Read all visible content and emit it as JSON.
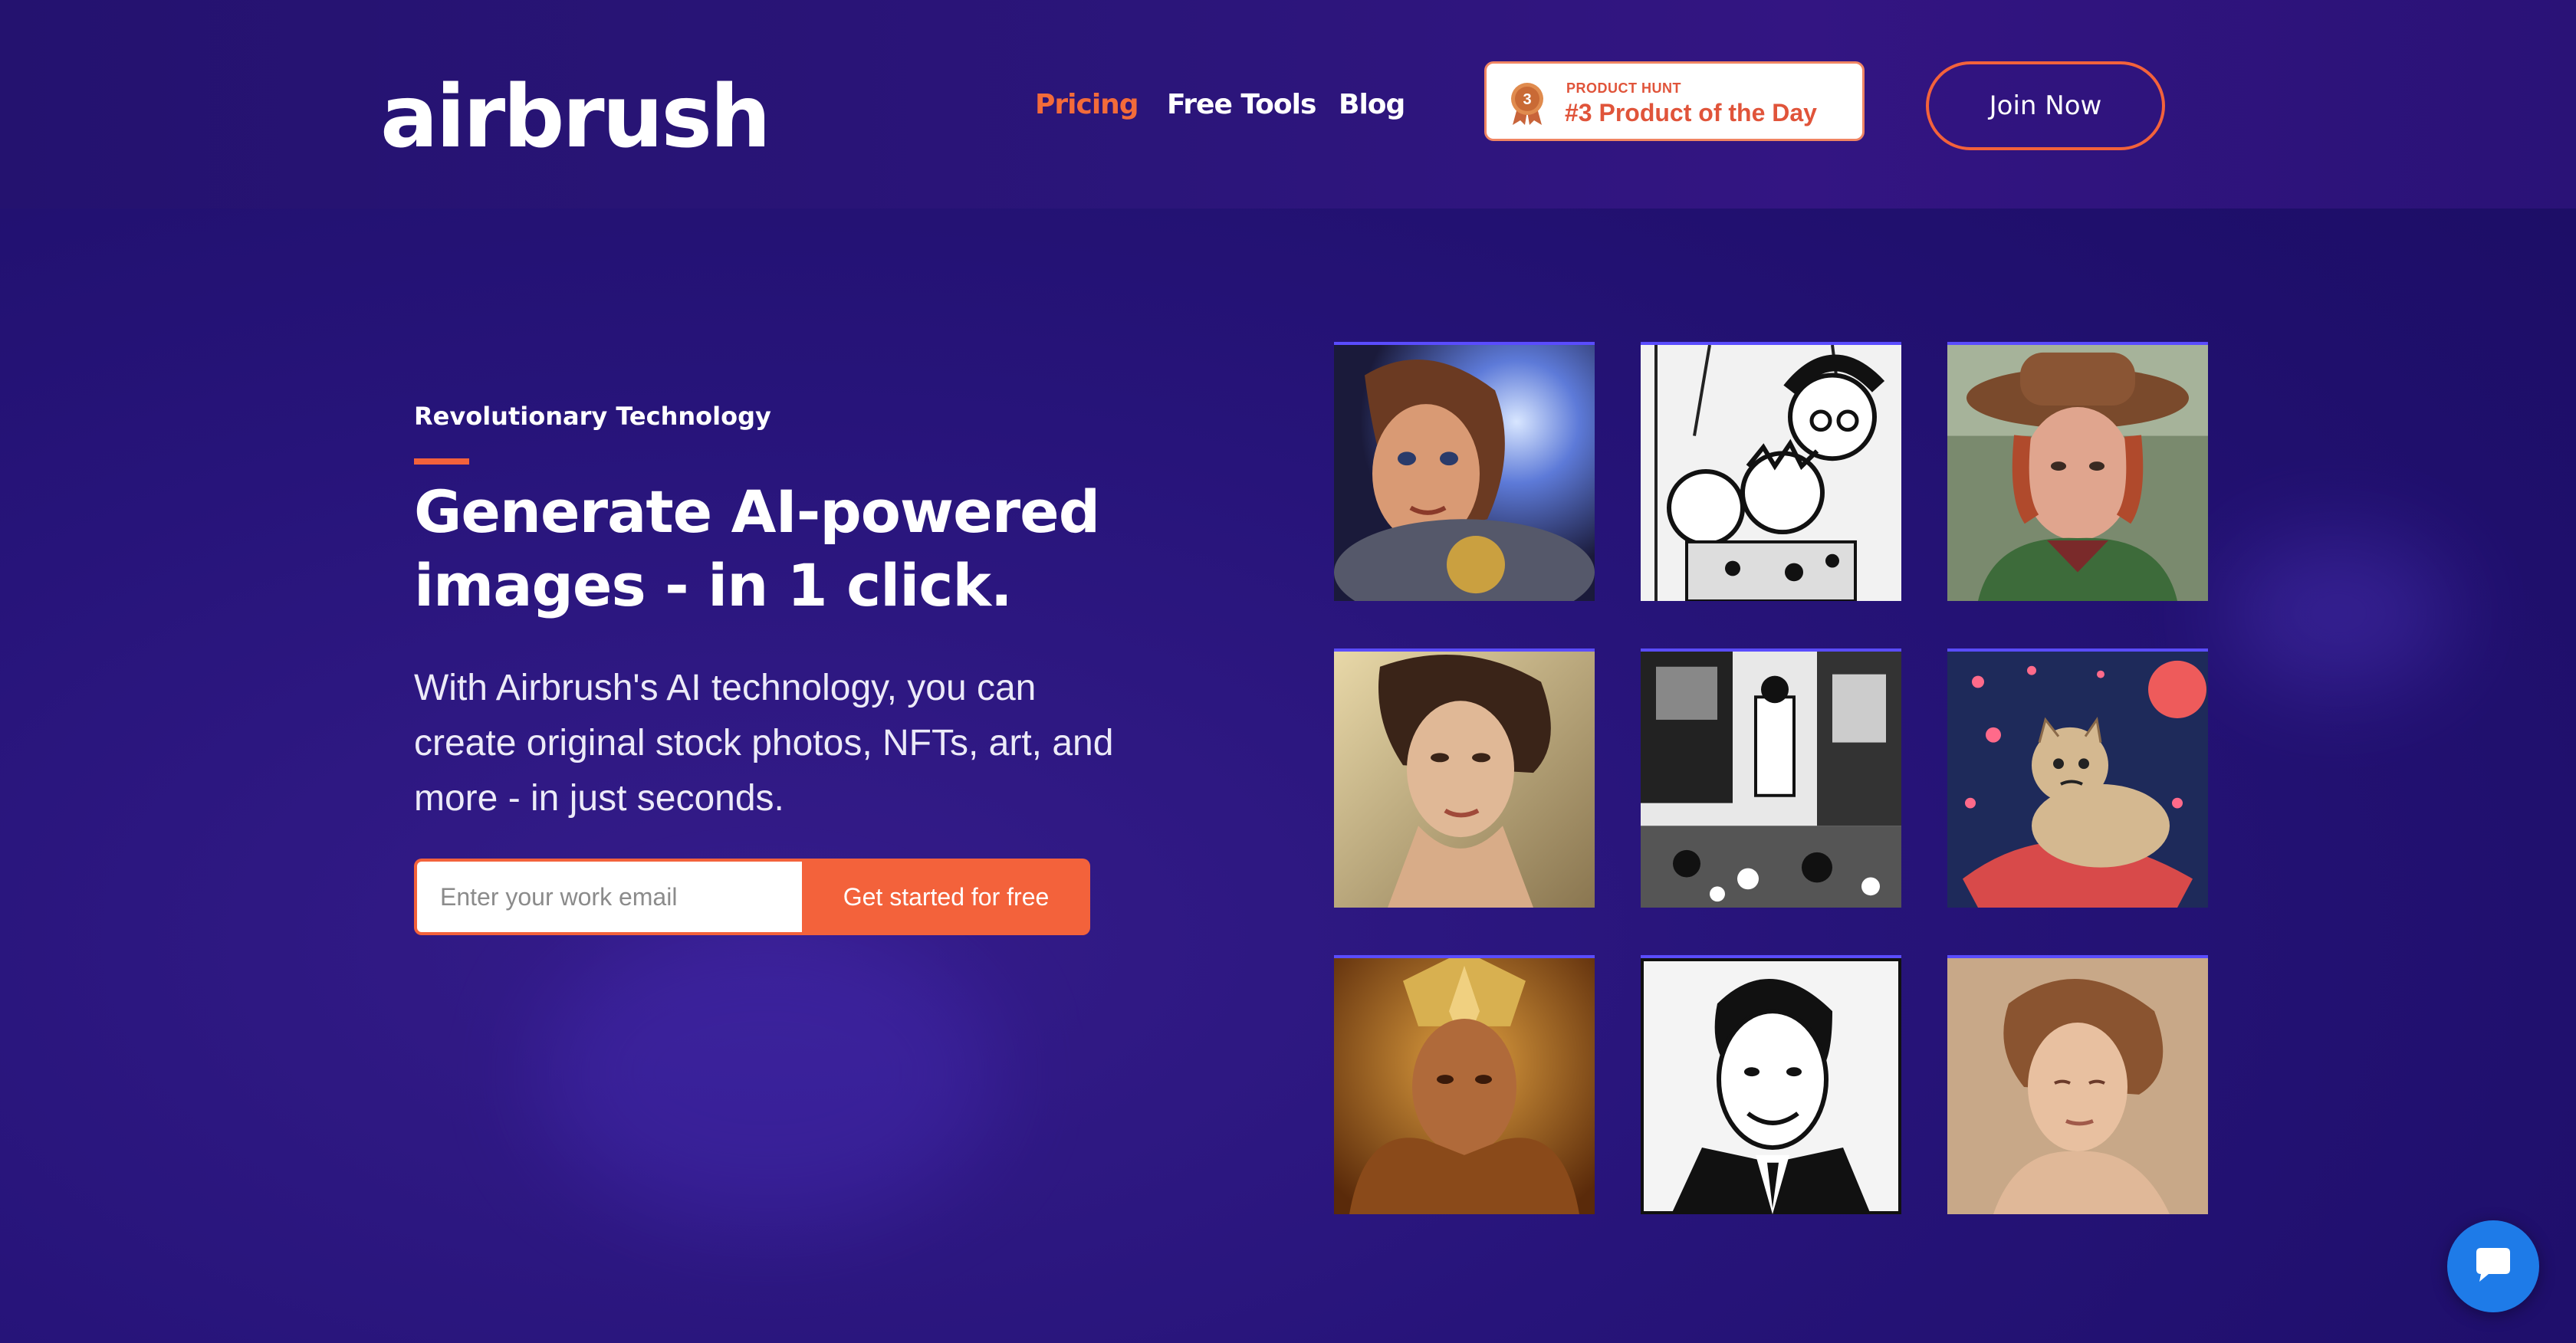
{
  "brand": {
    "logo_text": "airbrush"
  },
  "nav": {
    "pricing": "Pricing",
    "free_tools": "Free Tools",
    "blog": "Blog"
  },
  "product_hunt": {
    "rank": "3",
    "kicker": "PRODUCT HUNT",
    "title": "#3 Product of the Day"
  },
  "join_button": "Join Now",
  "hero": {
    "eyebrow": "Revolutionary Technology",
    "headline": "Generate AI-powered images - in 1 click.",
    "subtext": "With Airbrush's AI technology, you can create original stock photos, NFTs, art, and more - in just seconds.",
    "email_placeholder": "Enter your work email",
    "cta_label": "Get started for free"
  },
  "colors": {
    "accent": "#f3623b",
    "background": "#24126f",
    "chat": "#1e7be8"
  },
  "gallery": [
    {
      "name": "gallery-image-1",
      "icon": "animated-heroine-portrait"
    },
    {
      "name": "gallery-image-2",
      "icon": "manga-family-sketch"
    },
    {
      "name": "gallery-image-3",
      "icon": "woman-in-hat-portrait"
    },
    {
      "name": "gallery-image-4",
      "icon": "classical-woman-portrait"
    },
    {
      "name": "gallery-image-5",
      "icon": "manga-room-scene"
    },
    {
      "name": "gallery-image-6",
      "icon": "cat-in-space-illustration"
    },
    {
      "name": "gallery-image-7",
      "icon": "golden-warrior-portrait"
    },
    {
      "name": "gallery-image-8",
      "icon": "ink-man-in-suit"
    },
    {
      "name": "gallery-image-9",
      "icon": "soft-woman-portrait"
    }
  ],
  "chat": {
    "icon": "chat-bubble-icon"
  }
}
